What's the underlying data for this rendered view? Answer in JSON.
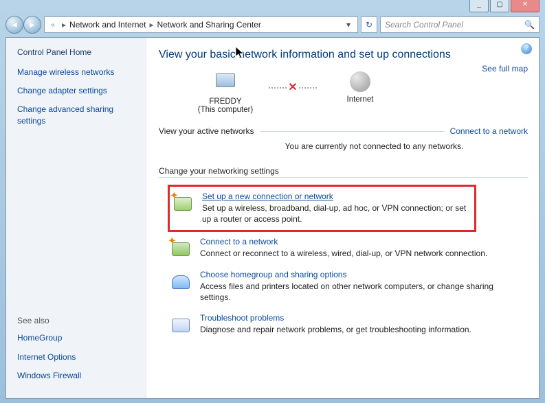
{
  "window_controls": {
    "minimize": "_",
    "maximize": "▢",
    "close": "✕"
  },
  "nav": {
    "back": "◄",
    "forward": "►"
  },
  "breadcrumb": {
    "icon": "«",
    "parent": "Network and Internet",
    "current": "Network and Sharing Center",
    "sep": "▸",
    "drop": "▾"
  },
  "refresh": "↻",
  "search": {
    "placeholder": "Search Control Panel",
    "icon": "🔍"
  },
  "help": "?",
  "sidebar": {
    "home": "Control Panel Home",
    "links": [
      "Manage wireless networks",
      "Change adapter settings",
      "Change advanced sharing settings"
    ],
    "see_also_hdr": "See also",
    "see_also": [
      "HomeGroup",
      "Internet Options",
      "Windows Firewall"
    ]
  },
  "main": {
    "title": "View your basic network information and set up connections",
    "full_map": "See full map",
    "node1_name": "FREDDY",
    "node1_sub": "(This computer)",
    "node2_name": "Internet",
    "cross": "✕",
    "active_hdr": "View your active networks",
    "connect_link": "Connect to a network",
    "no_conn": "You are currently not connected to any networks.",
    "change_hdr": "Change your networking settings",
    "tasks": [
      {
        "title": "Set up a new connection or network",
        "desc": "Set up a wireless, broadband, dial-up, ad hoc, or VPN connection; or set up a router or access point."
      },
      {
        "title": "Connect to a network",
        "desc": "Connect or reconnect to a wireless, wired, dial-up, or VPN network connection."
      },
      {
        "title": "Choose homegroup and sharing options",
        "desc": "Access files and printers located on other network computers, or change sharing settings."
      },
      {
        "title": "Troubleshoot problems",
        "desc": "Diagnose and repair network problems, or get troubleshooting information."
      }
    ]
  }
}
